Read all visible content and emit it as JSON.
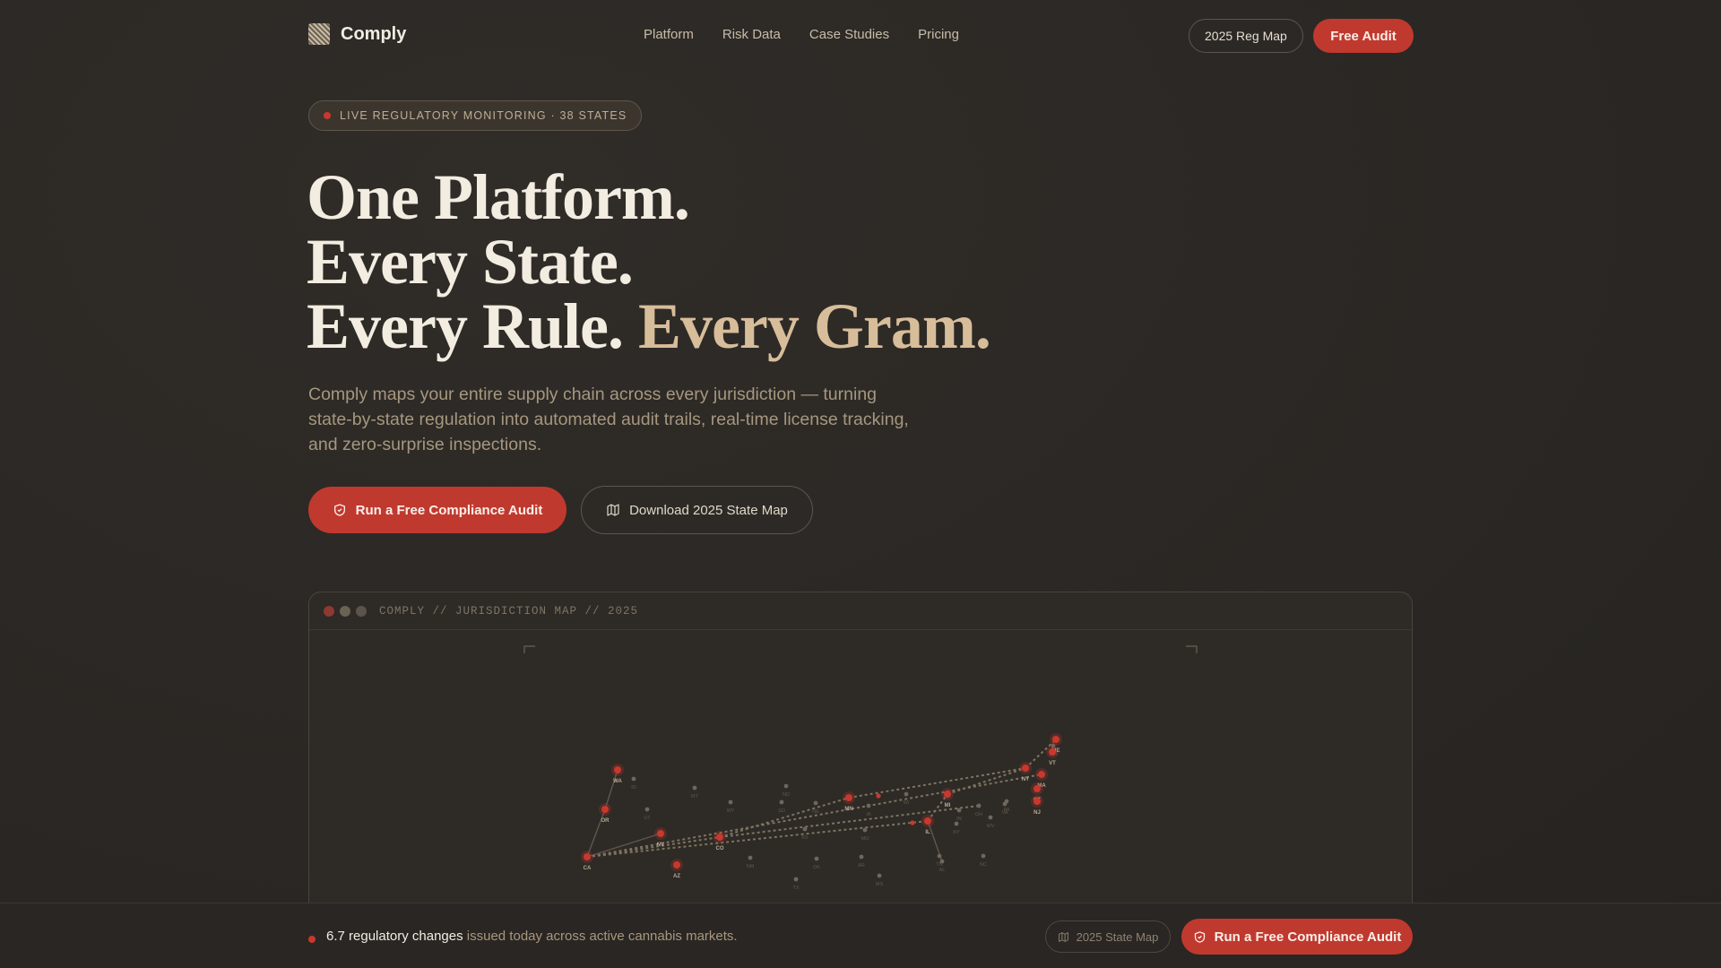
{
  "brand": {
    "name": "Comply"
  },
  "nav": {
    "links": [
      "Platform",
      "Risk Data",
      "Case Studies",
      "Pricing"
    ],
    "reg_map_button": "2025 Reg Map",
    "free_audit_button": "Free Audit"
  },
  "hero": {
    "badge": "LIVE REGULATORY MONITORING · 38 STATES",
    "headline_line1": "One Platform.",
    "headline_line2": "Every State.",
    "headline_line3a": "Every Rule.",
    "headline_line3b": "Every Gram.",
    "subtext": "Comply maps your entire supply chain across every jurisdiction — turning state-by-state regulation into automated audit trails, real-time license tracking, and zero-surprise inspections.",
    "primary_cta": "Run a Free Compliance Audit",
    "secondary_cta": "Download 2025 State Map"
  },
  "map_panel": {
    "title": "COMPLY // JURISDICTION MAP // 2025",
    "window_dot_colors": [
      "#8c3a32",
      "#6b6256",
      "#5a544c"
    ],
    "active_states": [
      {
        "code": "WA"
      },
      {
        "code": "OR"
      },
      {
        "code": "CA"
      },
      {
        "code": "NV"
      },
      {
        "code": "AZ"
      },
      {
        "code": "CO"
      },
      {
        "code": "MN"
      },
      {
        "code": "MI"
      },
      {
        "code": "IL"
      },
      {
        "code": "NY"
      },
      {
        "code": "ME"
      },
      {
        "code": "VT"
      },
      {
        "code": "MA"
      },
      {
        "code": "CT"
      },
      {
        "code": "NJ"
      }
    ],
    "inactive_states": [
      {
        "code": "ID"
      },
      {
        "code": "MT"
      },
      {
        "code": "ND"
      },
      {
        "code": "UT"
      },
      {
        "code": "WY"
      },
      {
        "code": "SD"
      },
      {
        "code": "NE"
      },
      {
        "code": "KS"
      },
      {
        "code": "IA"
      },
      {
        "code": "WI"
      },
      {
        "code": "MO"
      },
      {
        "code": "IN"
      },
      {
        "code": "OH"
      },
      {
        "code": "PA"
      },
      {
        "code": "NM"
      },
      {
        "code": "OK"
      },
      {
        "code": "TX"
      },
      {
        "code": "AR"
      },
      {
        "code": "KY"
      },
      {
        "code": "TN"
      },
      {
        "code": "WV"
      },
      {
        "code": "VA"
      },
      {
        "code": "MS"
      },
      {
        "code": "AL"
      },
      {
        "code": "NC"
      },
      {
        "code": "NH"
      }
    ]
  },
  "bottom_bar": {
    "highlight": "6.7 regulatory changes",
    "text": " issued today across active cannabis markets.",
    "map_button": "2025 State Map",
    "audit_button": "Run a Free Compliance Audit"
  },
  "colors": {
    "accent_red": "#c0392f",
    "accent_tan": "#d8bd9a",
    "background": "#2b2825"
  }
}
